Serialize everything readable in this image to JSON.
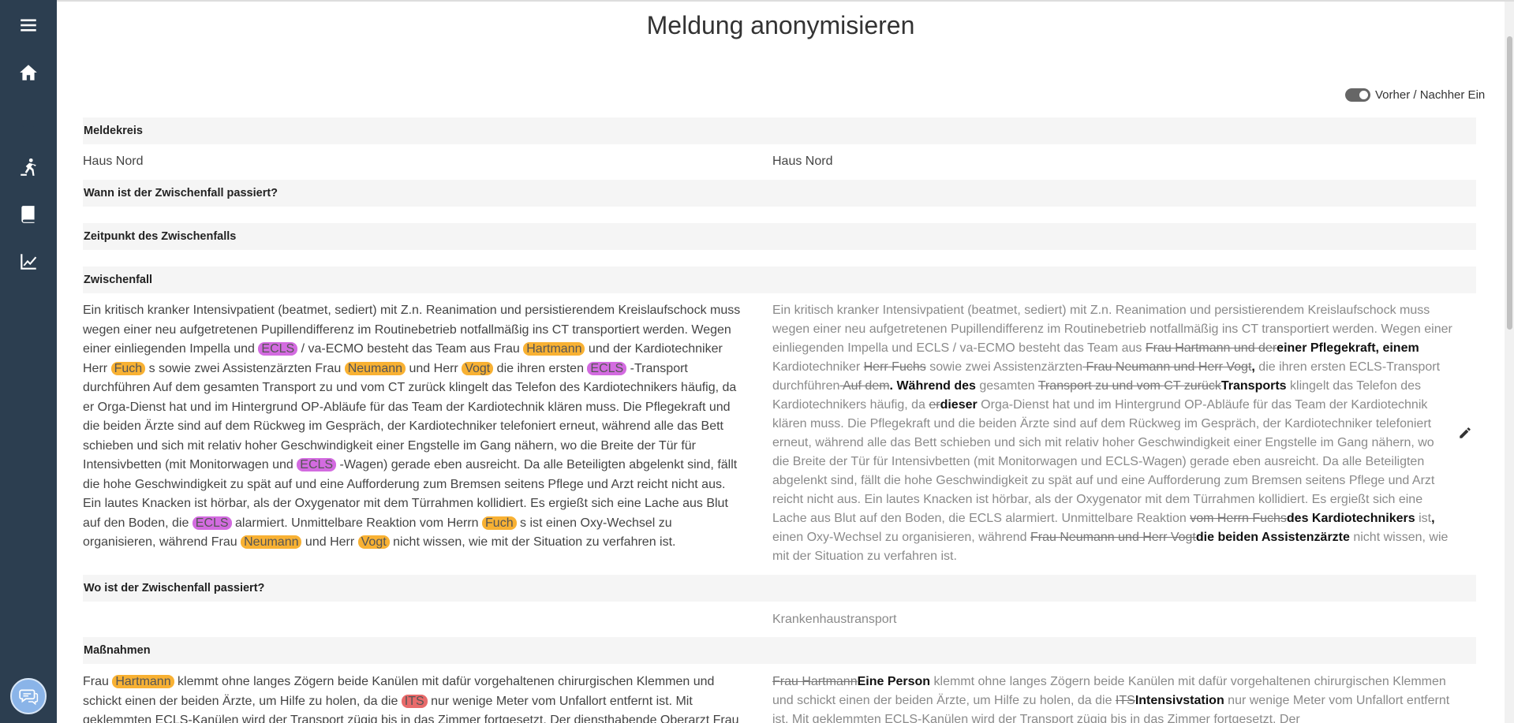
{
  "page": {
    "title": "Meldung anonymisieren",
    "toggle_label": "Vorher / Nachher Ein"
  },
  "sidebar": {
    "items": [
      {
        "icon": "menu-icon"
      },
      {
        "icon": "home-icon"
      },
      {
        "icon": "dashboard-icon"
      },
      {
        "icon": "fall-icon"
      },
      {
        "icon": "book-icon"
      },
      {
        "icon": "chart-icon"
      }
    ],
    "chat_icon": "chat-icon"
  },
  "sections": {
    "meldekreis": {
      "label": "Meldekreis",
      "before": "Haus Nord",
      "after": "Haus Nord"
    },
    "wann": {
      "label": "Wann ist der Zwischenfall passiert?"
    },
    "zeitpunkt": {
      "label": "Zeitpunkt des Zwischenfalls"
    },
    "zwischenfall": {
      "label": "Zwischenfall"
    },
    "wo": {
      "label": "Wo ist der Zwischenfall passiert?",
      "after": "Krankenhaustransport"
    },
    "massnahmen": {
      "label": "Maßnahmen"
    }
  },
  "zwischenfall_before": [
    {
      "t": "Ein kritisch kranker Intensivpatient (beatmet, sediert) mit Z.n. Reanimation und persistierendem Kreislaufschock muss wegen einer neu aufgetretenen Pupillendifferenz im Routinebetrieb notfallmäßig ins CT transportiert werden. Wegen einer einliegenden Impella und "
    },
    {
      "t": "ECLS",
      "k": "e"
    },
    {
      "t": " / va-ECMO besteht das Team aus Frau "
    },
    {
      "t": "Hartmann",
      "k": "n"
    },
    {
      "t": " und der Kardiotechniker Herr "
    },
    {
      "t": "Fuch",
      "k": "n"
    },
    {
      "t": " s sowie zwei Assistenzärzten Frau "
    },
    {
      "t": "Neumann",
      "k": "n"
    },
    {
      "t": " und Herr "
    },
    {
      "t": "Vogt",
      "k": "n"
    },
    {
      "t": " die ihren ersten "
    },
    {
      "t": "ECLS",
      "k": "e"
    },
    {
      "t": " -Transport durchführen Auf dem gesamten Transport zu und vom CT zurück klingelt das Telefon des Kardiotechnikers häufig, da er Orga-Dienst hat und im Hintergrund OP-Abläufe für das Team der Kardiotechnik klären muss. Die Pflegekraft und die beiden Ärzte sind auf dem Rückweg im Gespräch, der Kardiotechniker telefoniert erneut, während alle das Bett schieben und sich mit relativ hoher Geschwindigkeit einer Engstelle im Gang nähern, wo die Breite der Tür für Intensivbetten (mit Monitorwagen und "
    },
    {
      "t": "ECLS",
      "k": "e"
    },
    {
      "t": " -Wagen) gerade eben ausreicht. Da alle Beteiligten abgelenkt sind, fällt die hohe Geschwindigkeit zu spät auf und eine Aufforderung zum Bremsen seitens Pflege und Arzt reicht nicht aus. Ein lautes Knacken ist hörbar, als der Oxygenator mit dem Türrahmen kollidiert. Es ergießt sich eine Lache aus Blut auf den Boden, die "
    },
    {
      "t": "ECLS",
      "k": "e"
    },
    {
      "t": " alarmiert. Unmittelbare Reaktion vom Herrn "
    },
    {
      "t": "Fuch",
      "k": "n"
    },
    {
      "t": " s ist einen Oxy-Wechsel zu organisieren, während Frau "
    },
    {
      "t": "Neumann",
      "k": "n"
    },
    {
      "t": " und Herr "
    },
    {
      "t": "Vogt",
      "k": "n"
    },
    {
      "t": " nicht wissen, wie mit der Situation zu verfahren ist."
    }
  ],
  "zwischenfall_after": [
    {
      "t": "Ein kritisch kranker Intensivpatient (beatmet, sediert) mit Z.n. Reanimation und persistierendem Kreislaufschock muss wegen einer neu aufgetretenen Pupillendifferenz im Routinebetrieb notfallmäßig ins CT transportiert werden. Wegen einer einliegenden Impella und ECLS / va-ECMO besteht das Team aus "
    },
    {
      "t": "Frau Hartmann und der",
      "k": "del"
    },
    {
      "t": "einer Pflegekraft, einem",
      "k": "ins"
    },
    {
      "t": " Kardiotechniker "
    },
    {
      "t": "Herr Fuchs",
      "k": "del"
    },
    {
      "t": " sowie zwei Assistenzärzten"
    },
    {
      "t": " Frau Neumann und Herr Vogt",
      "k": "del"
    },
    {
      "t": ",",
      "k": "ins"
    },
    {
      "t": " die ihren ersten ECLS-Transport durchführen"
    },
    {
      "t": " Auf dem",
      "k": "del"
    },
    {
      "t": ". Während des",
      "k": "ins"
    },
    {
      "t": " gesamten "
    },
    {
      "t": "Transport zu und vom CT zurück",
      "k": "del"
    },
    {
      "t": "Transports",
      "k": "ins"
    },
    {
      "t": " klingelt das Telefon des Kardiotechnikers häufig, da "
    },
    {
      "t": "er",
      "k": "del"
    },
    {
      "t": "dieser",
      "k": "ins"
    },
    {
      "t": " Orga-Dienst hat und im Hintergrund OP-Abläufe für das Team der Kardiotechnik klären muss. Die Pflegekraft und die beiden Ärzte sind auf dem Rückweg im Gespräch, der Kardiotechniker telefoniert erneut, während alle das Bett schieben und sich mit relativ hoher Geschwindigkeit einer Engstelle im Gang nähern, wo die Breite der Tür für Intensivbetten (mit Monitorwagen und ECLS-Wagen) gerade eben ausreicht. Da alle Beteiligten abgelenkt sind, fällt die hohe Geschwindigkeit zu spät auf und eine Aufforderung zum Bremsen seitens Pflege und Arzt reicht nicht aus. Ein lautes Knacken ist hörbar, als der Oxygenator mit dem Türrahmen kollidiert. Es ergießt sich eine Lache aus Blut auf den Boden, die ECLS alarmiert. Unmittelbare Reaktion "
    },
    {
      "t": "vom Herrn Fuchs",
      "k": "del"
    },
    {
      "t": "des Kardiotechnikers",
      "k": "ins"
    },
    {
      "t": " ist"
    },
    {
      "t": ",",
      "k": "ins"
    },
    {
      "t": " einen Oxy-Wechsel zu organisieren, während "
    },
    {
      "t": "Frau Neumann und Herr Vogt",
      "k": "del"
    },
    {
      "t": "die beiden Assistenzärzte",
      "k": "ins"
    },
    {
      "t": " nicht wissen, wie mit der Situation zu verfahren ist."
    }
  ],
  "massnahmen_before": [
    {
      "t": "Frau "
    },
    {
      "t": "Hartmann",
      "k": "n"
    },
    {
      "t": " klemmt ohne langes Zögern beide Kanülen mit dafür vorgehaltenen chirurgischen Klemmen und schickt einen der beiden Ärzte, um Hilfe zu holen, da die "
    },
    {
      "t": "ITS",
      "k": "r"
    },
    {
      "t": " nur wenige Meter vom Unfallort entfernt ist. Mit geklemmten ECLS-Kanülen wird der Transport zügig bis in das Zimmer fortgesetzt. Der diensthabende Oberarzt Frau"
    }
  ],
  "massnahmen_after": [
    {
      "t": "Frau Hartmann",
      "k": "del"
    },
    {
      "t": "Eine Person",
      "k": "ins"
    },
    {
      "t": " klemmt ohne langes Zögern beide Kanülen mit dafür vorgehaltenen chirurgischen Klemmen und schickt einen der beiden Ärzte, um Hilfe zu holen, da die "
    },
    {
      "t": "ITS",
      "k": "del"
    },
    {
      "t": "Intensivstation",
      "k": "ins"
    },
    {
      "t": " nur wenige Meter vom Unfallort entfernt ist. Mit geklemmten ECLS-Kanülen wird der Transport zügig bis in das Zimmer fortgesetzt. Der"
    }
  ]
}
